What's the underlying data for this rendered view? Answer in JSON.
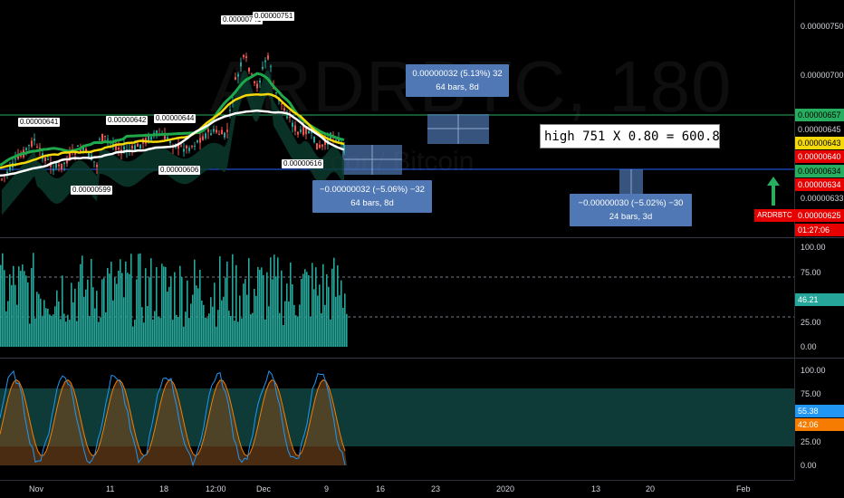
{
  "watermark": {
    "symbol": "ARDRBTC, 180",
    "description": "Ardor / Bitcoin"
  },
  "price_axis": {
    "labels": [
      "0.00000750",
      "0.00000700",
      "0.00000657",
      "0.00000645",
      "0.00000643",
      "0.00000640",
      "0.00000634",
      "0.00000634",
      "0.00000633",
      "0.00000625"
    ],
    "tag_colors": {
      "0.00000657": "#27ae60",
      "0.00000643": "#f5d90a",
      "0.00000640": "#e60000",
      "0.00000634a": "#27ae60",
      "0.00000634b": "#e60000",
      "0.00000625": "#e60000"
    }
  },
  "symbol_tag": "ARDRBTC",
  "countdown": "01:27:06",
  "rsi_axis": {
    "labels": [
      "100.00",
      "75.00",
      "50.00",
      "25.00",
      "0.00"
    ],
    "current": "46.21"
  },
  "stoch_axis": {
    "labels": [
      "100.00",
      "75.00",
      "25.00",
      "0.00"
    ],
    "k": "55.38",
    "d": "42.06"
  },
  "time_axis": {
    "labels": [
      "Nov",
      "11",
      "18",
      "12:00",
      "Dec",
      "9",
      "16",
      "23",
      "2020",
      "13",
      "20",
      "Feb"
    ]
  },
  "peak_labels": [
    "0.00000741",
    "0.00000751",
    "0.00000641",
    "0.00000642",
    "0.00000644",
    "0.00000599",
    "0.00000606",
    "0.00000616"
  ],
  "measure_up": {
    "line1": "0.00000032 (5.13%) 32",
    "line2": "64 bars, 8d"
  },
  "measure_down1": {
    "line1": "−0.00000032 (−5.06%) −32",
    "line2": "64 bars, 8d"
  },
  "measure_down2": {
    "line1": "−0.00000030 (−5.02%) −30",
    "line2": "24 bars, 3d"
  },
  "formula": "high 751 X 0.80 = 600.8",
  "colors": {
    "green": "#27ae60",
    "blue": "#2962ff",
    "teal": "#26a69a",
    "measure": "#4f78b4",
    "red": "#e60000",
    "yellow": "#f5d90a",
    "orange": "#f57c00"
  }
}
